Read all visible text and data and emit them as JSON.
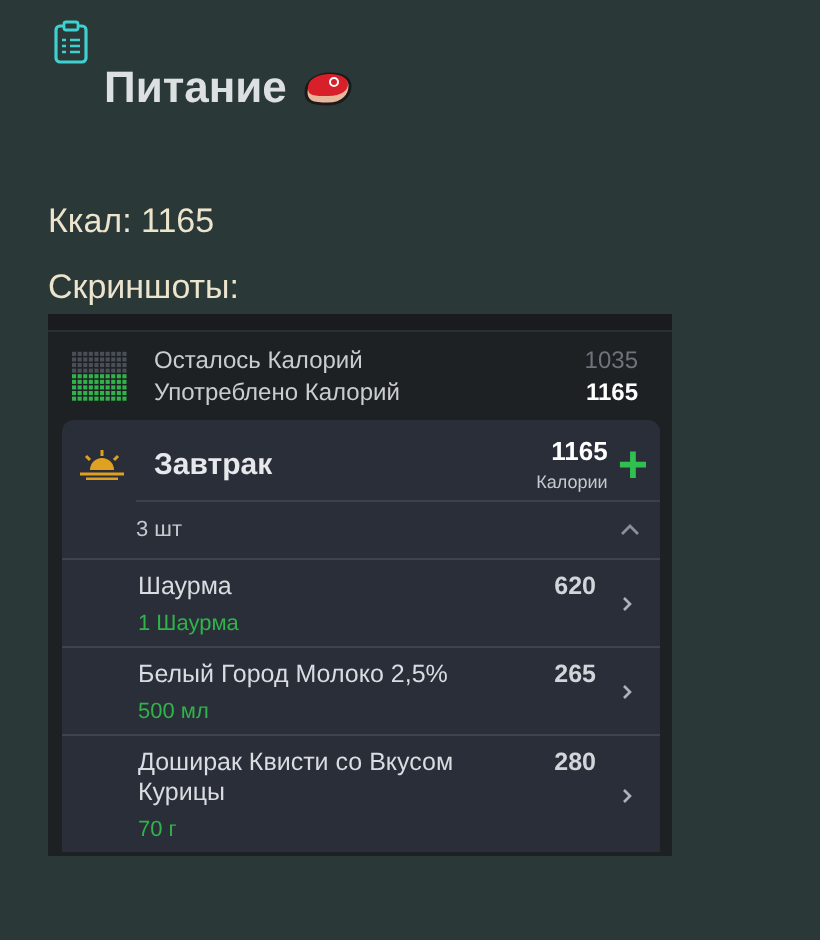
{
  "page": {
    "title": "Питание",
    "calories_line": "Ккал: 1165",
    "screenshots_label": "Скриншоты:"
  },
  "screenshot": {
    "summary": {
      "rows": [
        {
          "label": "Осталось Калорий",
          "value": "1035",
          "emphasis": false
        },
        {
          "label": "Употреблено Калорий",
          "value": "1165",
          "emphasis": true
        }
      ]
    },
    "meal": {
      "title": "Завтрак",
      "calories": "1165",
      "calories_label": "Калории",
      "add_icon": "+",
      "count": "3 шт",
      "expanded": true,
      "items": [
        {
          "name": "Шаурма",
          "calories": "620",
          "portion": "1 Шаурма"
        },
        {
          "name": "Белый Город Молоко 2,5%",
          "calories": "265",
          "portion": "500 мл"
        },
        {
          "name": "Доширак Квисти со Вкусом Курицы",
          "calories": "280",
          "portion": "70 г"
        }
      ]
    }
  }
}
